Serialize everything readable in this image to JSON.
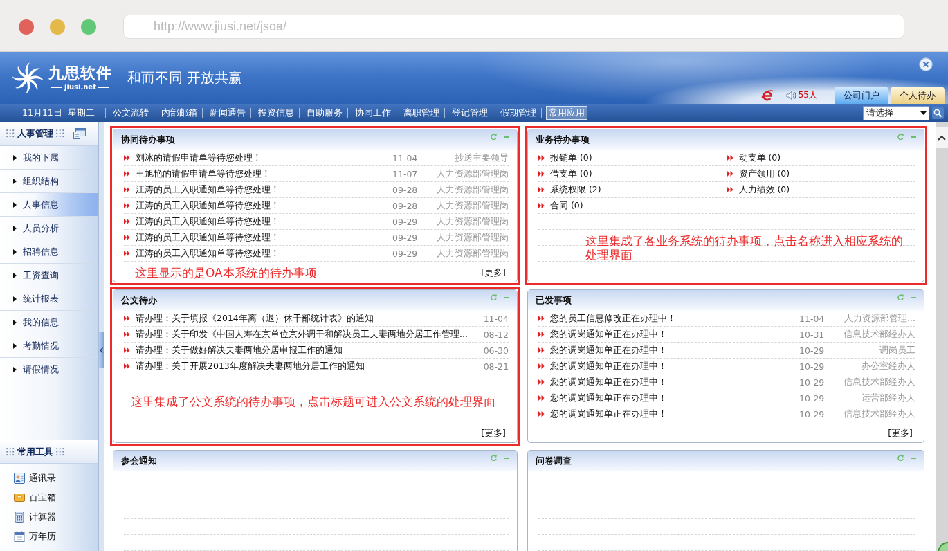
{
  "browser": {
    "url": "http://www.jiusi.net/jsoa/",
    "window_controls": [
      {
        "color": "#e0625b"
      },
      {
        "color": "#e4b94a"
      },
      {
        "color": "#61c878"
      }
    ]
  },
  "header": {
    "brand": "九思软件",
    "domain": "jiusi.net",
    "slogan": "和而不同 开放共赢",
    "online_count": "55人",
    "tabs": [
      {
        "label": "公司门户",
        "selected": false
      },
      {
        "label": "个人待办",
        "selected": true
      }
    ]
  },
  "navbar": {
    "date": "11月11日  星期二",
    "items": [
      {
        "label": "公文流转",
        "selected": false
      },
      {
        "label": "内部邮箱",
        "selected": false
      },
      {
        "label": "新闻通告",
        "selected": false
      },
      {
        "label": "投资信息",
        "selected": false
      },
      {
        "label": "自助服务",
        "selected": false
      },
      {
        "label": "协同工作",
        "selected": false
      },
      {
        "label": "离职管理",
        "selected": false
      },
      {
        "label": "登记管理",
        "selected": false
      },
      {
        "label": "假期管理",
        "selected": false
      },
      {
        "label": "常用应用",
        "selected": true
      }
    ],
    "select": {
      "value": "请选择"
    }
  },
  "sidebar": {
    "title": "人事管理",
    "items": [
      {
        "label": "我的下属",
        "selected": false
      },
      {
        "label": "组织结构",
        "selected": false
      },
      {
        "label": "人事信息",
        "selected": true
      },
      {
        "label": "人员分析",
        "selected": false
      },
      {
        "label": "招聘信息",
        "selected": false
      },
      {
        "label": "工资查询",
        "selected": false
      },
      {
        "label": "统计报表",
        "selected": false
      },
      {
        "label": "我的信息",
        "selected": false
      },
      {
        "label": "考勤情况",
        "selected": false
      },
      {
        "label": "请假情况",
        "selected": false
      }
    ],
    "tools_title": "常用工具",
    "tools": [
      {
        "label": "通讯录",
        "kind": "contacts"
      },
      {
        "label": "百宝箱",
        "kind": "toolbox"
      },
      {
        "label": "计算器",
        "kind": "calculator"
      },
      {
        "label": "万年历",
        "kind": "calendar"
      }
    ]
  },
  "panels": [
    {
      "title": "协同待办事项",
      "kind": "list",
      "framed": true,
      "rows": [
        {
          "title": "刘冰的请假申请单等待您处理！",
          "date": "11-04",
          "dept": "抄送主要领导"
        },
        {
          "title": "王旭艳的请假申请单等待您处理！",
          "date": "11-07",
          "dept": "人力资源部管理岗"
        },
        {
          "title": "江涛的员工入职通知单等待您处理！",
          "date": "09-28",
          "dept": "人力资源部管理岗"
        },
        {
          "title": "江涛的员工入职通知单等待您处理！",
          "date": "09-28",
          "dept": "人力资源部管理岗"
        },
        {
          "title": "江涛的员工入职通知单等待您处理！",
          "date": "09-29",
          "dept": "人力资源部管理岗"
        },
        {
          "title": "江涛的员工入职通知单等待您处理！",
          "date": "09-29",
          "dept": "人力资源部管理岗"
        },
        {
          "title": "江涛的员工入职通知单等待您处理！",
          "date": "09-29",
          "dept": "人力资源部管理岗"
        }
      ],
      "more": "[更多]",
      "note": "这里显示的是OA本系统的待办事项"
    },
    {
      "title": "业务待办事项",
      "kind": "grid",
      "framed": true,
      "items": [
        {
          "label": "报销单 (0)"
        },
        {
          "label": "动支单 (0)"
        },
        {
          "label": "借支单 (0)"
        },
        {
          "label": "资产领用 (0)"
        },
        {
          "label": "系统权限 (2)"
        },
        {
          "label": "人力绩效 (0)"
        },
        {
          "label": "合同 (0)"
        }
      ],
      "note": "这里集成了各业务系统的待办事项，点击名称进入相应系统的处理界面"
    },
    {
      "title": "公文待办",
      "kind": "list",
      "framed": true,
      "rows": [
        {
          "title": "请办理：关于填报《2014年离（退）休干部统计表》的通知",
          "date": "11-04"
        },
        {
          "title": "请办理：关于印发《中国人寿在京单位京外调干和解决员工夫妻两地分居工作管理...",
          "date": "08-12"
        },
        {
          "title": "请办理：关于做好解决夫妻两地分居申报工作的通知",
          "date": "06-30"
        },
        {
          "title": "请办理：关于开展2013年度解决夫妻两地分居工作的通知",
          "date": "08-21"
        }
      ],
      "more": "[更多]",
      "note": "这里集成了公文系统的待办事项，点击标题可进入公文系统的处理界面"
    },
    {
      "title": "已发事项",
      "kind": "list",
      "framed": false,
      "rows": [
        {
          "title": "您的员工信息修改正在办理中！",
          "date": "11-04",
          "dept": "人力资源部管理..."
        },
        {
          "title": "您的调岗通知单正在办理中！",
          "date": "10-31",
          "dept": "信息技术部经办人"
        },
        {
          "title": "您的调岗通知单正在办理中！",
          "date": "10-29",
          "dept": "调岗员工"
        },
        {
          "title": "您的调岗通知单正在办理中！",
          "date": "10-29",
          "dept": "办公室经办人"
        },
        {
          "title": "您的调岗通知单正在办理中！",
          "date": "10-29",
          "dept": "信息技术部经办人"
        },
        {
          "title": "您的调岗通知单正在办理中！",
          "date": "10-29",
          "dept": "运营部经办人"
        },
        {
          "title": "您的调岗通知单正在办理中！",
          "date": "10-29",
          "dept": "信息技术部经办人"
        }
      ],
      "more": "[更多]"
    },
    {
      "title": "参会通知",
      "kind": "list",
      "framed": false
    },
    {
      "title": "问卷调查",
      "kind": "list",
      "framed": false
    }
  ]
}
